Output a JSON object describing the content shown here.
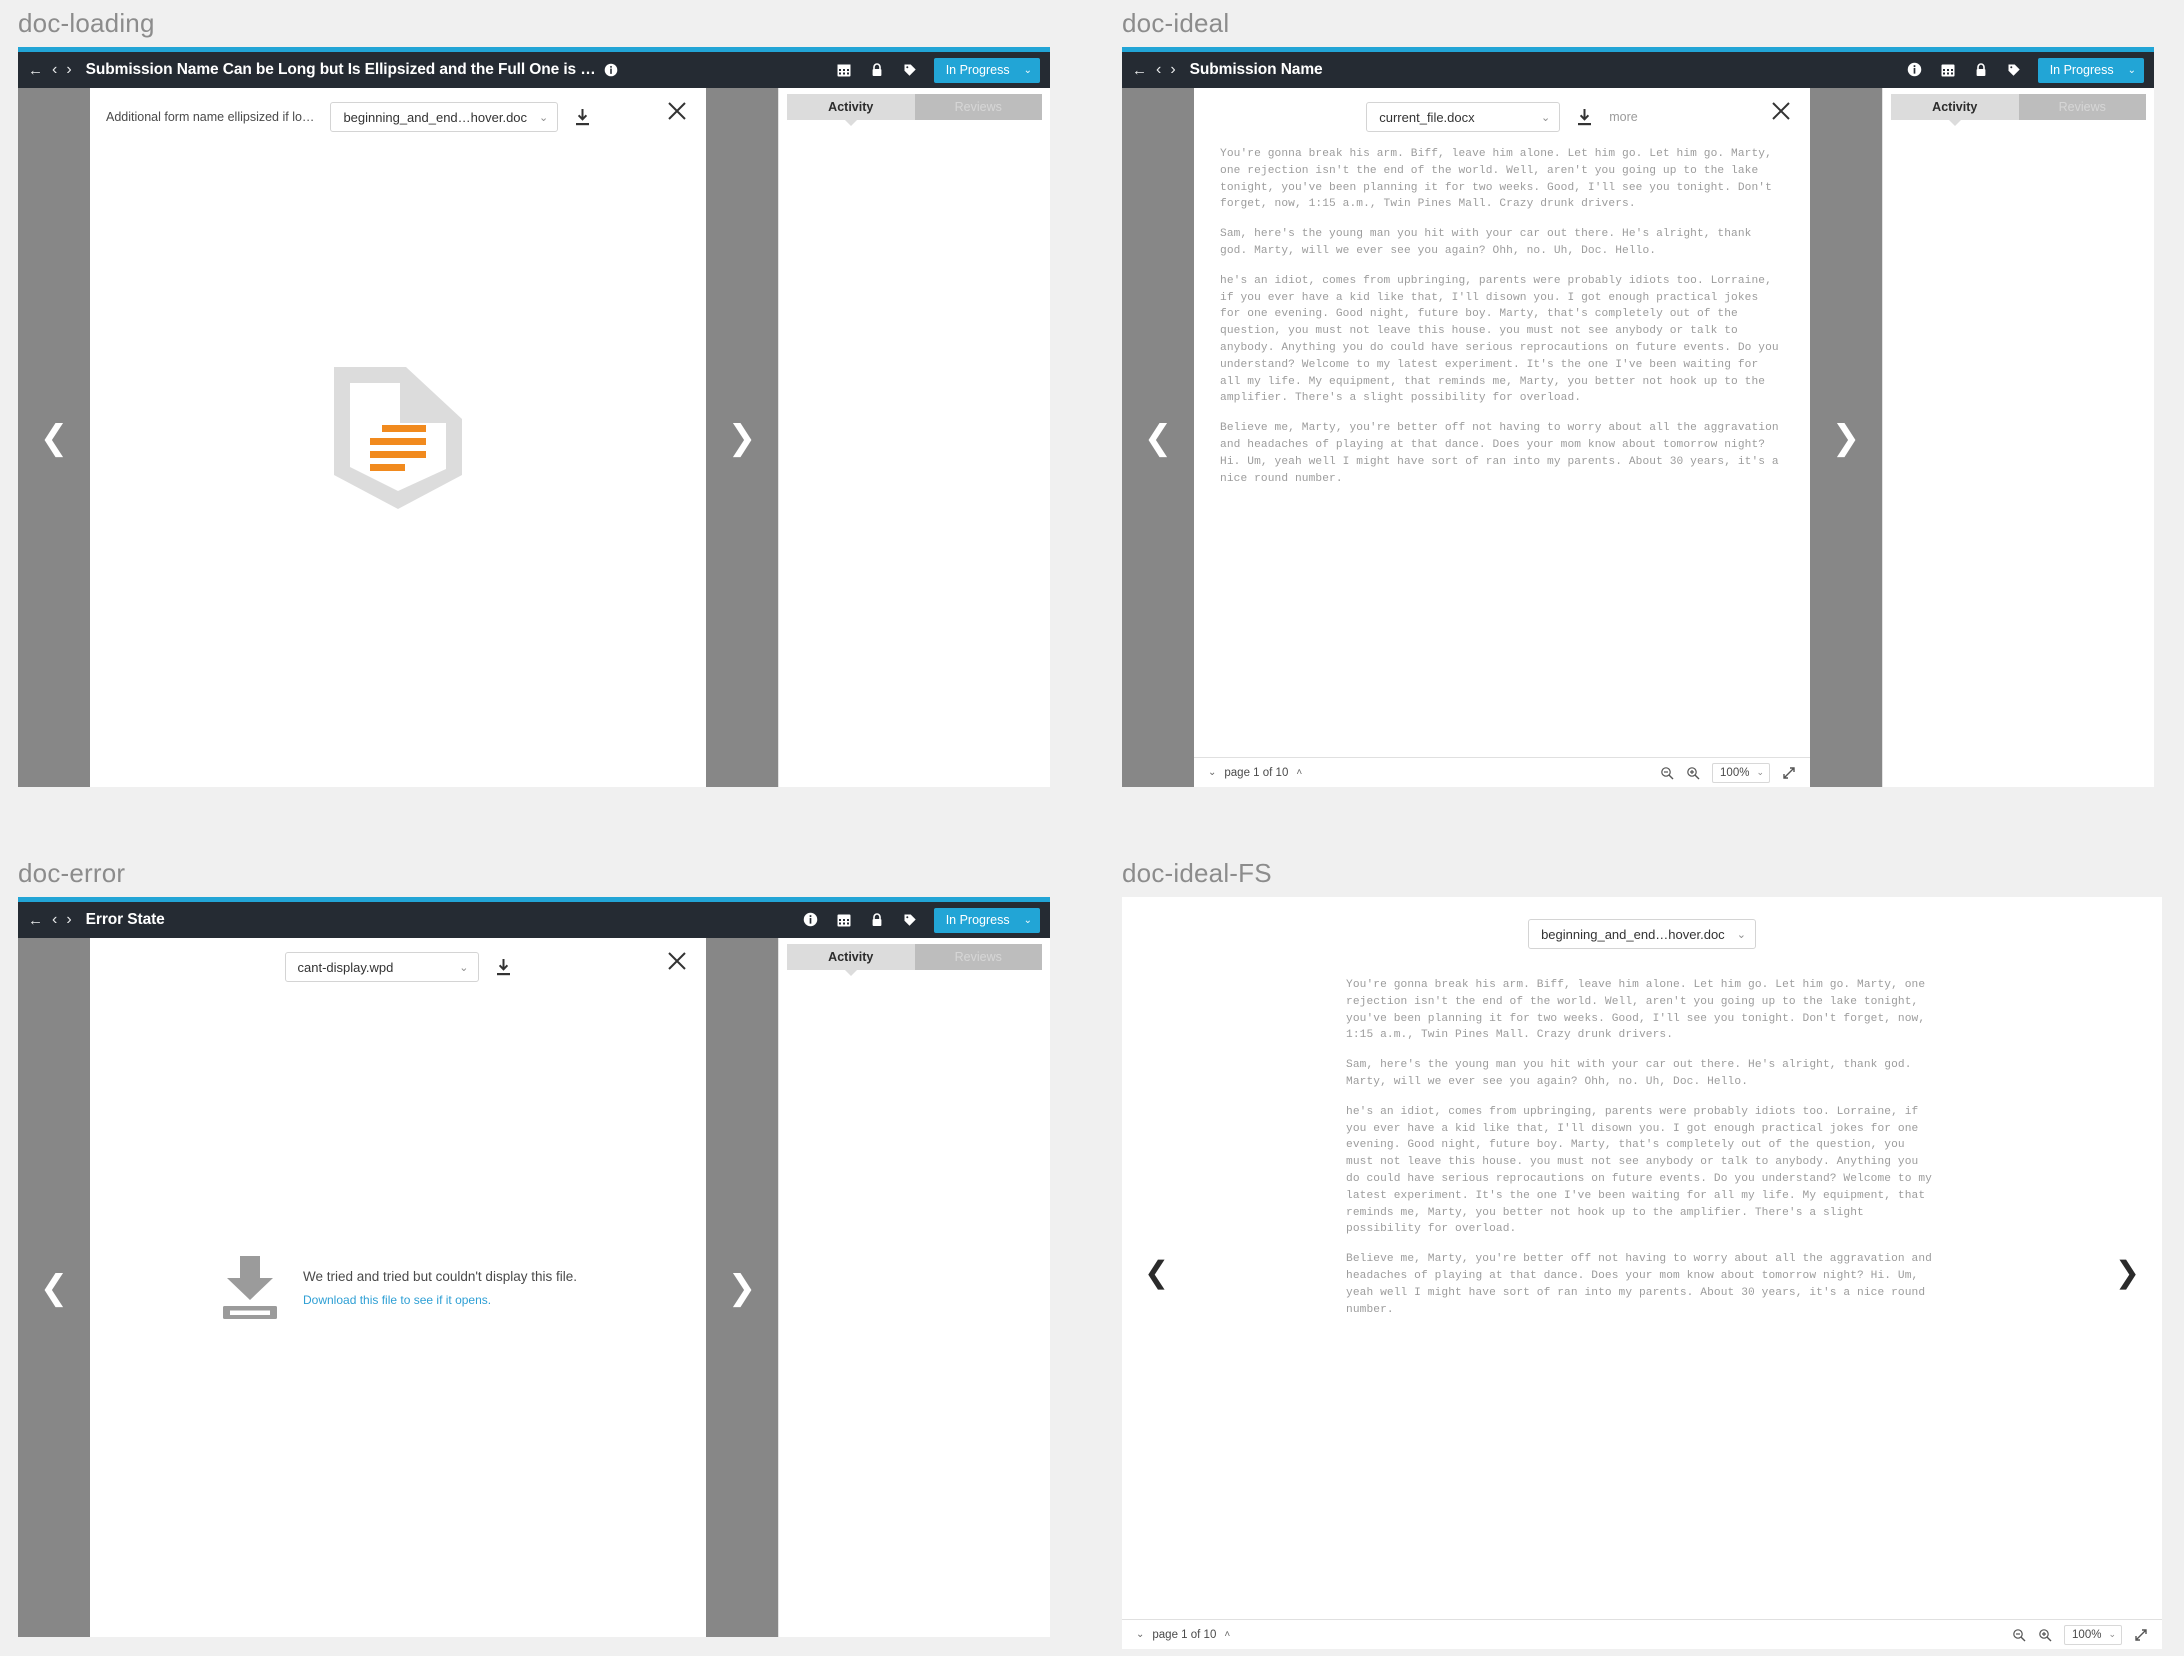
{
  "panels": {
    "loading": {
      "label": "doc-loading"
    },
    "ideal": {
      "label": "doc-ideal"
    },
    "error": {
      "label": "doc-error"
    },
    "ideal_fs": {
      "label": "doc-ideal-FS"
    }
  },
  "header": {
    "back_icon": "←",
    "prev_icon": "‹",
    "next_icon": "›",
    "title_long": "Submission Name Can be Long but Is Ellipsized and the Full One is Visible on Hover.",
    "title_short": "Submission Name",
    "title_error": "Error State",
    "info_icon": "info-icon",
    "calendar_icon": "calendar-icon",
    "lock_icon": "lock-icon",
    "tag_icon": "tag-icon",
    "status_label": "In Progress",
    "status_caret": "⌄",
    "accent_color": "#22a5d6",
    "bar_color": "#252b33"
  },
  "filebar": {
    "form_label": "Additional form name ellipsized if lo…",
    "file_hover_doc": "beginning_and_end…hover.doc",
    "file_current_docx": "current_file.docx",
    "file_cant_display": "cant-display.wpd",
    "caret": "⌄",
    "more_label": "more",
    "download_icon": "download-icon",
    "close_icon": "close-icon"
  },
  "viewer": {
    "prev_arrow": "❮",
    "next_arrow": "❯",
    "bg_color": "#878787"
  },
  "loading": {
    "placeholder_icon": "document-placeholder-icon",
    "shield_color": "#dcdcdc",
    "bar_color": "#f18a1e"
  },
  "error": {
    "icon": "download-large-icon",
    "message": "We tried and tried but couldn't display this file.",
    "link": "Download this file to see if it opens.",
    "link_color": "#2e9fd4"
  },
  "sidebar": {
    "tabs": [
      {
        "label": "Activity",
        "state": "active"
      },
      {
        "label": "Reviews",
        "state": "inactive"
      }
    ]
  },
  "pagebar": {
    "down_caret": "⌄",
    "up_caret": "˄",
    "page_text": "page 1 of 10",
    "zoom_out_icon": "zoom-out-icon",
    "zoom_in_icon": "zoom-in-icon",
    "zoom_value": "100%",
    "zoom_caret": "⌄",
    "expand_icon": "expand-icon"
  },
  "document": {
    "paragraphs": [
      "You're gonna break his arm. Biff, leave him alone. Let him go. Let him go. Marty, one rejection isn't the end of the world. Well, aren't you going up to the lake tonight, you've been planning it for two weeks. Good, I'll see you tonight. Don't forget, now, 1:15 a.m., Twin Pines Mall. Crazy drunk drivers.",
      "Sam, here's the young man you hit with your car out there. He's alright, thank god. Marty, will we ever see you again? Ohh, no. Uh, Doc. Hello.",
      "he's an idiot, comes from upbringing, parents were probably idiots too. Lorraine, if you ever have a kid like that, I'll disown you. I got enough practical jokes for one evening. Good night, future boy. Marty, that's completely out of the question, you must not leave this house. you must not see anybody or talk to anybody. Anything you do could have serious reprocautions on future events. Do you understand? Welcome to my latest experiment. It's the one I've been waiting for all my life. My equipment, that reminds me, Marty, you better not hook up to the amplifier. There's a slight possibility for overload.",
      "Believe me, Marty, you're better off not having to worry about all the aggravation and headaches of playing at that dance. Does your mom know about tomorrow night? Hi. Um, yeah well I might have sort of ran into my parents. About 30 years, it's a nice round number."
    ]
  }
}
